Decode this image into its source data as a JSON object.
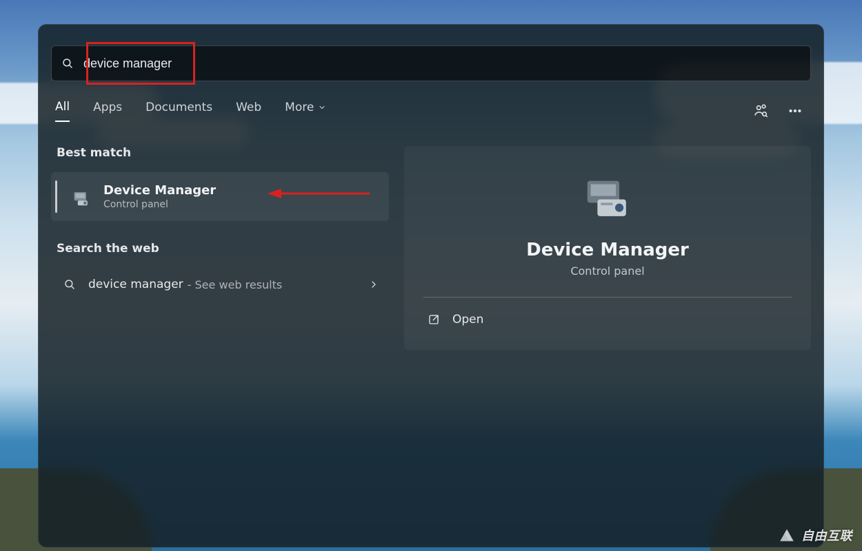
{
  "search": {
    "query": "device manager"
  },
  "tabs": {
    "all": "All",
    "apps": "Apps",
    "documents": "Documents",
    "web": "Web",
    "more": "More"
  },
  "sections": {
    "best_match": "Best match",
    "search_web": "Search the web"
  },
  "result": {
    "title": "Device Manager",
    "subtitle": "Control panel"
  },
  "web": {
    "query": "device manager",
    "hint": "- See web results"
  },
  "preview": {
    "title": "Device Manager",
    "subtitle": "Control panel",
    "actions": {
      "open": "Open"
    }
  },
  "watermark": "自由互联"
}
